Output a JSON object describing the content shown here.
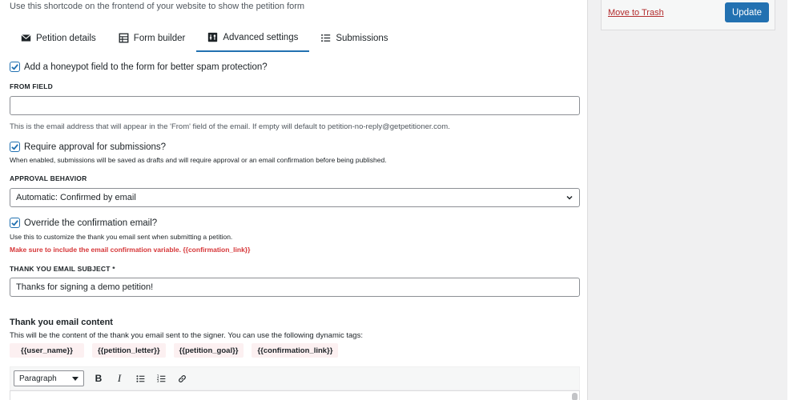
{
  "top_hint": "Use this shortcode on the frontend of your website to show the petition form",
  "tabs": [
    {
      "label": "Petition details",
      "icon": "envelope-icon"
    },
    {
      "label": "Form builder",
      "icon": "table-icon"
    },
    {
      "label": "Advanced settings",
      "icon": "settings-icon",
      "active": true
    },
    {
      "label": "Submissions",
      "icon": "list-icon"
    }
  ],
  "settings": {
    "honeypot_label": "Add a honeypot field to the form for better spam protection?",
    "honeypot_checked": true,
    "from_field_label": "FROM FIELD",
    "from_field_value": "",
    "from_field_help": "This is the email address that will appear in the 'From' field of the email. If empty will default to petition-no-reply@getpetitioner.com.",
    "approval_label": "Require approval for submissions?",
    "approval_checked": true,
    "approval_help": "When enabled, submissions will be saved as drafts and will require approval or an email confirmation before being published.",
    "approval_behavior_label": "APPROVAL BEHAVIOR",
    "approval_behavior_value": "Automatic: Confirmed by email",
    "override_label": "Override the confirmation email?",
    "override_checked": true,
    "override_help": "Use this to customize the thank you email sent when submitting a petition.",
    "override_warning": "Make sure to include the email confirmation variable. {{confirmation_link}}",
    "subject_label": "THANK YOU EMAIL SUBJECT *",
    "subject_value": "Thanks for signing a demo petition!"
  },
  "content_section": {
    "title": "Thank you email content",
    "description": "This will be the content of the thank you email sent to the signer. You can use the following dynamic tags:",
    "tags": [
      "{{user_name}}",
      "{{petition_letter}}",
      "{{petition_goal}}",
      "{{confirmation_link}}"
    ]
  },
  "editor": {
    "format_value": "Paragraph",
    "bold_label": "B",
    "italic_label": "I"
  },
  "sidebar": {
    "trash_label": "Move to Trash",
    "update_label": "Update"
  },
  "colors": {
    "accent": "#2271b1",
    "warning": "#d63638",
    "tag_bg": "#fcf0f1"
  }
}
